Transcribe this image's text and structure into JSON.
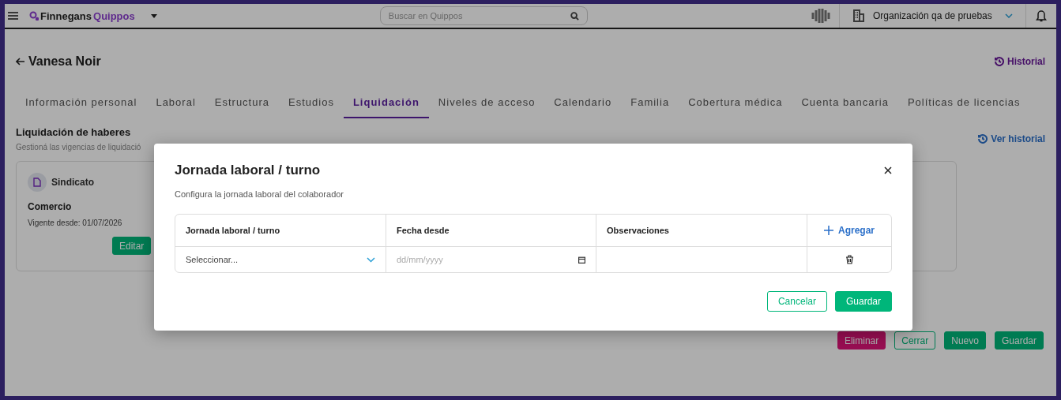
{
  "header": {
    "logo": {
      "brand": "Finnegans",
      "product": "Quippos"
    },
    "search": {
      "placeholder": "Buscar en Quippos"
    },
    "organization": "Organización qa de pruebas"
  },
  "page": {
    "title": "Vanesa Noir",
    "history_link": "Historial",
    "tabs": [
      {
        "label": "Información personal",
        "selected": false
      },
      {
        "label": "Laboral",
        "selected": false
      },
      {
        "label": "Estructura",
        "selected": false
      },
      {
        "label": "Estudios",
        "selected": false
      },
      {
        "label": "Liquidación",
        "selected": true
      },
      {
        "label": "Niveles de acceso",
        "selected": false
      },
      {
        "label": "Calendario",
        "selected": false
      },
      {
        "label": "Familia",
        "selected": false
      },
      {
        "label": "Cobertura médica",
        "selected": false
      },
      {
        "label": "Cuenta bancaria",
        "selected": false
      },
      {
        "label": "Políticas de licencias",
        "selected": false
      }
    ],
    "section": {
      "title": "Liquidación de haberes",
      "subtitle": "Gestioná las vigencias de liquidació",
      "view_history": "Ver historial"
    },
    "card": {
      "label": "Sindicato",
      "value": "Comercio",
      "since": "Vigente desde: 01/07/2026",
      "button": "Editar"
    },
    "actions": [
      {
        "label": "Eliminar",
        "kind": "danger"
      },
      {
        "label": "Cerrar",
        "kind": "outline"
      },
      {
        "label": "Nuevo",
        "kind": "primary"
      },
      {
        "label": "Guardar",
        "kind": "primary"
      }
    ]
  },
  "modal": {
    "title": "Jornada laboral / turno",
    "subtitle": "Configura la jornada laboral del colaborador",
    "columns": [
      "Jornada laboral / turno",
      "Fecha desde",
      "Observaciones"
    ],
    "add_label": "Agregar",
    "rows": [
      {
        "shift_placeholder": "Seleccionar...",
        "date_placeholder": "dd/mm/yyyy"
      }
    ],
    "buttons": [
      {
        "label": "Cancelar",
        "kind": "outline"
      },
      {
        "label": "Guardar",
        "kind": "primary"
      }
    ]
  }
}
